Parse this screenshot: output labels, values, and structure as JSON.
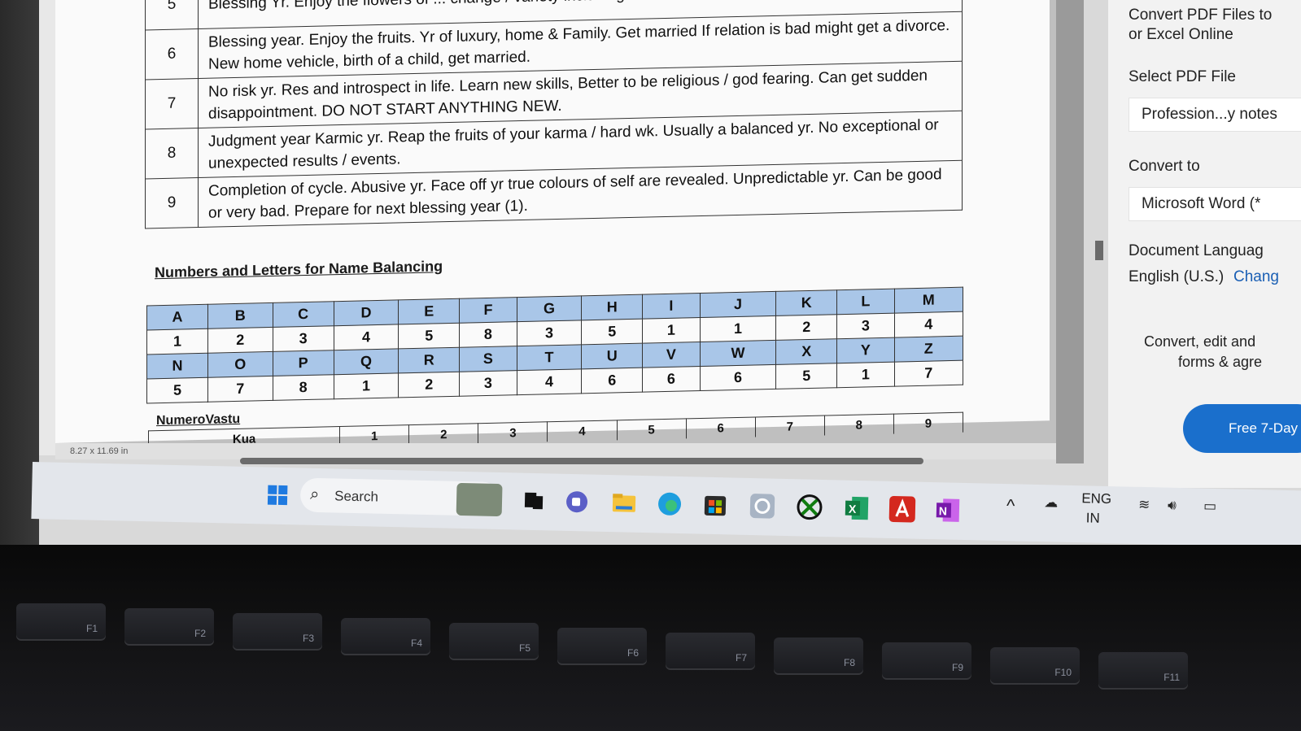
{
  "document": {
    "upper_table": [
      {
        "num": "5",
        "text": "Blessing Yr. Enjoy the flowers of ... change / variety including a career shift."
      },
      {
        "num": "6",
        "text": "Blessing year. Enjoy the fruits. Yr of luxury, home & Family. Get married If relation is bad might get a divorce. New home vehicle, birth of a child, get married."
      },
      {
        "num": "7",
        "text": "No risk yr. Res and introspect in life. Learn new skills, Better to be religious / god fearing. Can get sudden disappointment. DO NOT START ANYTHING NEW."
      },
      {
        "num": "8",
        "text": "Judgment year Karmic yr. Reap the fruits of your karma / hard wk. Usually a balanced yr. No exceptional or unexpected results / events."
      },
      {
        "num": "9",
        "text": "Completion of cycle. Abusive yr. Face off yr true colours of self are revealed. Unpredictable yr. Can be good or very bad. Prepare for next blessing year (1)."
      }
    ],
    "section_title": "Numbers and Letters for Name Balancing",
    "letters_row1": [
      "A",
      "B",
      "C",
      "D",
      "E",
      "F",
      "G",
      "H",
      "I",
      "J",
      "K",
      "L",
      "M"
    ],
    "numbers_row1": [
      "1",
      "2",
      "3",
      "4",
      "5",
      "8",
      "3",
      "5",
      "1",
      "1",
      "2",
      "3",
      "4"
    ],
    "letters_row2": [
      "N",
      "O",
      "P",
      "Q",
      "R",
      "S",
      "T",
      "U",
      "V",
      "W",
      "X",
      "Y",
      "Z"
    ],
    "numbers_row2": [
      "5",
      "7",
      "8",
      "1",
      "2",
      "3",
      "4",
      "6",
      "6",
      "6",
      "5",
      "1",
      "7"
    ],
    "subsection_title": "NumeroVastu",
    "vastu_header": [
      "Kua",
      "1",
      "2",
      "3",
      "4",
      "5",
      "6",
      "7",
      "8",
      "9"
    ],
    "page_size": "8.27 x 11.69 in"
  },
  "right_panel": {
    "heading": "Convert PDF Files to\nor Excel Online",
    "heading_line1": "Convert PDF Files to",
    "heading_line2": "or Excel Online",
    "select_label": "Select PDF File",
    "selected_file": "Profession...y notes",
    "convert_to_label": "Convert to",
    "convert_to_value": "Microsoft Word (*",
    "doc_lang_label": "Document Languag",
    "doc_lang_value": "English (U.S.)",
    "change_label": "Chang",
    "promo_line1": "Convert, edit and",
    "promo_line2": "forms & agre",
    "free_button": "Free 7-Day"
  },
  "taskbar": {
    "search_placeholder": "Search",
    "lang_line1": "ENG",
    "lang_line2": "IN",
    "icons": [
      "windows-start-icon",
      "widgets-icon",
      "task-view-icon",
      "teams-chat-icon",
      "file-explorer-icon",
      "edge-icon",
      "store-icon",
      "cortana-icon",
      "xbox-icon",
      "excel-icon",
      "acrobat-icon",
      "onenote-icon"
    ]
  },
  "keyboard": {
    "keys": [
      "F1",
      "F2",
      "F3",
      "F4",
      "F5",
      "F6",
      "F7",
      "F8",
      "F9",
      "F10",
      "F11"
    ]
  },
  "colors": {
    "table_header_blue": "#a9c6e8",
    "acrobat_red": "#d4281e",
    "free_button_blue": "#1a6fcc"
  }
}
